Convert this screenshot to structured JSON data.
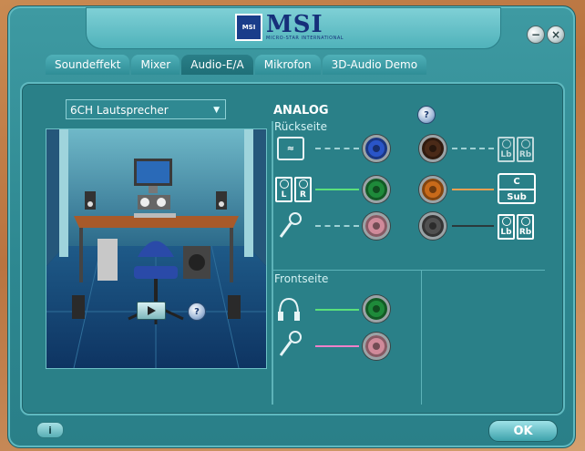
{
  "logo": {
    "text": "MSI",
    "sub": "MICRO-STAR INTERNATIONAL",
    "badge": "MSI"
  },
  "window": {
    "minimize": "−",
    "close": "×"
  },
  "tabs": [
    "Soundeffekt",
    "Mixer",
    "Audio-E/A",
    "Mikrofon",
    "3D-Audio Demo"
  ],
  "active_tab": "Audio-E/A",
  "speaker_config": {
    "selected": "6CH Lautsprecher"
  },
  "analog": {
    "title": "ANALOG",
    "rear_label": "Rückseite",
    "front_label": "Frontseite",
    "speaker_labels": {
      "lb": "Lb",
      "rb": "Rb",
      "l": "L",
      "r": "R",
      "c": "C",
      "sub": "Sub"
    }
  },
  "jack_colors": {
    "blue": "#2a55c8",
    "green": "#1e8a3a",
    "pink": "#d08a9a",
    "brown": "#4a2a18",
    "orange": "#c86a1a",
    "gray": "#505050",
    "front_green": "#1e8a3a",
    "front_pink": "#d08a9a"
  },
  "icons": [
    "minimize-icon",
    "close-icon",
    "help-icon",
    "play-icon",
    "info-icon",
    "line-in-icon",
    "speaker-icon",
    "microphone-icon",
    "headphone-icon"
  ],
  "buttons": {
    "ok": "OK",
    "info": "i",
    "help": "?"
  }
}
